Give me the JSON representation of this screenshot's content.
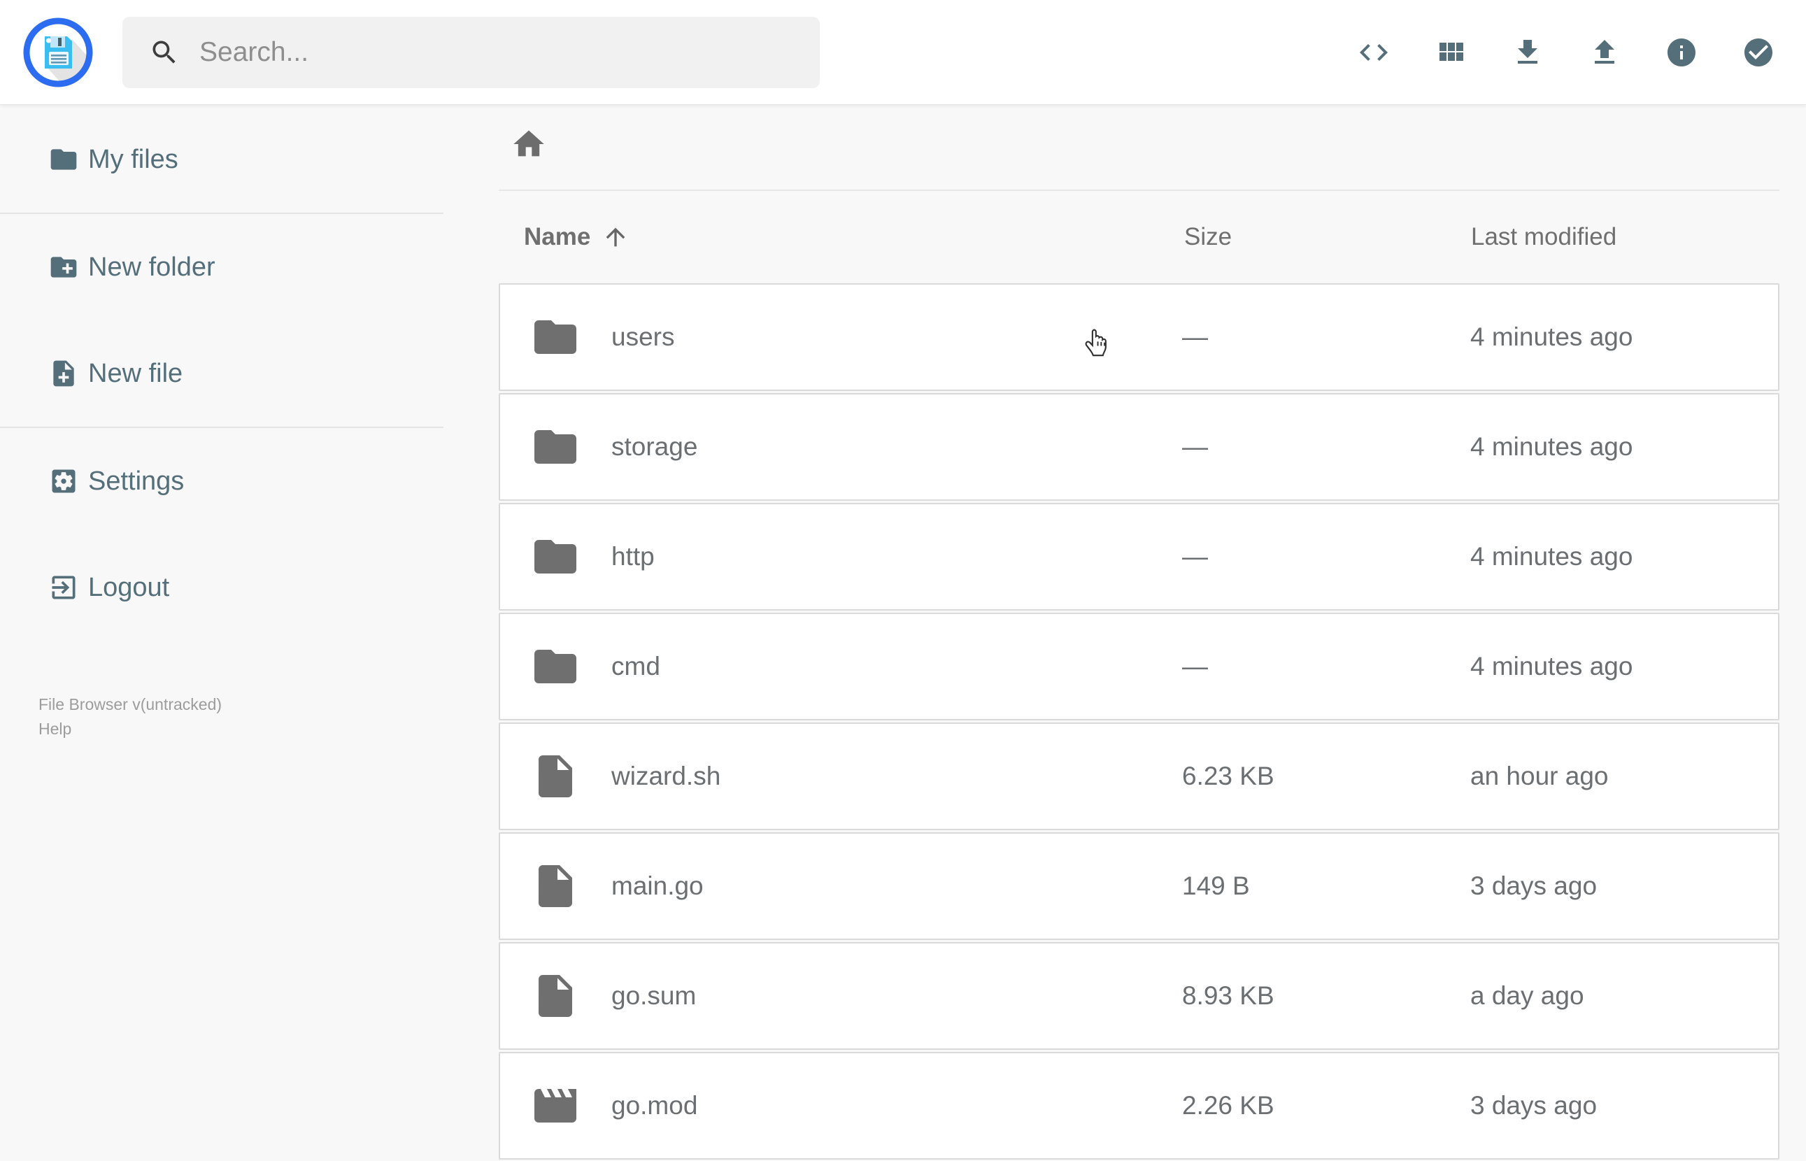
{
  "header": {
    "search": {
      "placeholder": "Search..."
    },
    "actions": [
      {
        "label": "Toggle shell",
        "icon": "code-icon"
      },
      {
        "label": "Switch view",
        "icon": "grid-view-icon"
      },
      {
        "label": "Download",
        "icon": "download-icon"
      },
      {
        "label": "Upload",
        "icon": "upload-icon"
      },
      {
        "label": "Info",
        "icon": "info-icon"
      },
      {
        "label": "Select multiple",
        "icon": "check-circle-icon"
      }
    ]
  },
  "sidebar": {
    "items": [
      {
        "label": "My files",
        "icon": "folder-icon"
      },
      {
        "label": "New folder",
        "icon": "new-folder-icon"
      },
      {
        "label": "New file",
        "icon": "new-file-icon"
      },
      {
        "label": "Settings",
        "icon": "settings-icon"
      },
      {
        "label": "Logout",
        "icon": "logout-icon"
      }
    ],
    "footer": {
      "version": "File Browser v(untracked)",
      "help": "Help"
    }
  },
  "breadcrumb": {
    "root_icon": "home-icon"
  },
  "listing": {
    "columns": {
      "name": "Name",
      "size": "Size",
      "modified": "Last modified"
    },
    "sort": {
      "column": "Name",
      "direction": "ascending",
      "icon": "arrow-up-icon"
    },
    "rows": [
      {
        "name": "users",
        "type": "folder",
        "size": "—",
        "modified": "4 minutes ago"
      },
      {
        "name": "storage",
        "type": "folder",
        "size": "—",
        "modified": "4 minutes ago"
      },
      {
        "name": "http",
        "type": "folder",
        "size": "—",
        "modified": "4 minutes ago"
      },
      {
        "name": "cmd",
        "type": "folder",
        "size": "—",
        "modified": "4 minutes ago"
      },
      {
        "name": "wizard.sh",
        "type": "file",
        "size": "6.23 KB",
        "modified": "an hour ago"
      },
      {
        "name": "main.go",
        "type": "file",
        "size": "149 B",
        "modified": "3 days ago"
      },
      {
        "name": "go.sum",
        "type": "file",
        "size": "8.93 KB",
        "modified": "a day ago"
      },
      {
        "name": "go.mod",
        "type": "movie",
        "size": "2.26 KB",
        "modified": "3 days ago"
      }
    ]
  },
  "colors": {
    "accent_blue": "#2b6cf0",
    "logo_floppy_blue": "#3abdf1",
    "icon_slate": "#546e7a",
    "listing_gray": "#6f6f6f",
    "page_background": "#f8f8f8",
    "card_background": "#ffffff"
  }
}
